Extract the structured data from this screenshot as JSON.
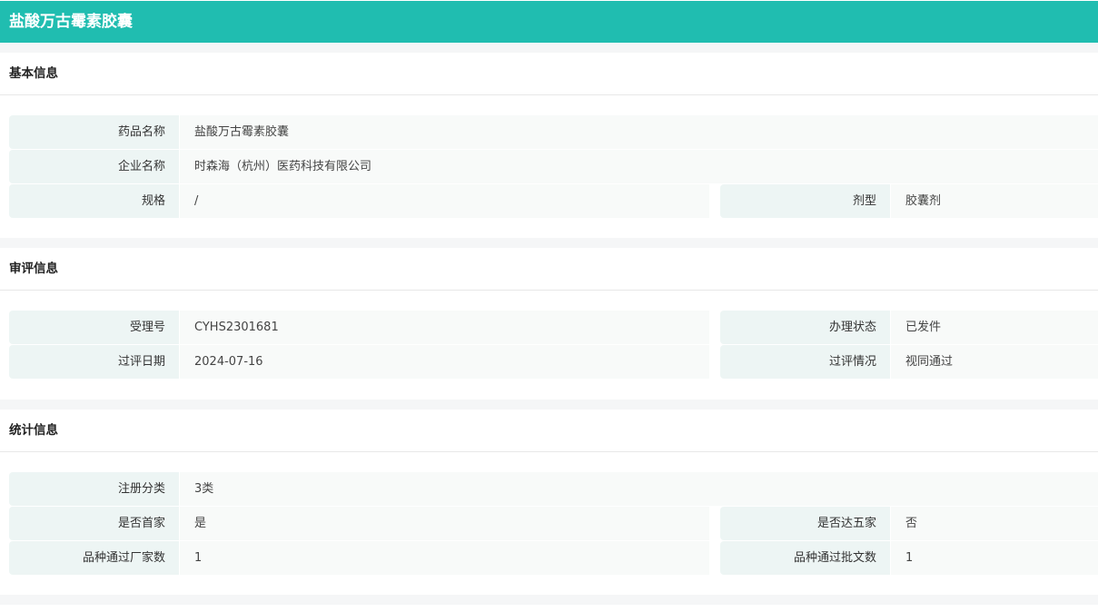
{
  "title": "盐酸万古霉素胶囊",
  "sections": [
    {
      "title": "基本信息",
      "rows": [
        [
          {
            "label": "药品名称",
            "value": "盐酸万古霉素胶囊"
          }
        ],
        [
          {
            "label": "企业名称",
            "value": "时森海（杭州）医药科技有限公司"
          }
        ],
        [
          {
            "label": "规格",
            "value": "/"
          },
          {
            "label": "剂型",
            "value": "胶囊剂"
          }
        ]
      ]
    },
    {
      "title": "审评信息",
      "rows": [
        [
          {
            "label": "受理号",
            "value": "CYHS2301681"
          },
          {
            "label": "办理状态",
            "value": "已发件"
          }
        ],
        [
          {
            "label": "过评日期",
            "value": "2024-07-16"
          },
          {
            "label": "过评情况",
            "value": "视同通过"
          }
        ]
      ]
    },
    {
      "title": "统计信息",
      "rows": [
        [
          {
            "label": "注册分类",
            "value": "3类"
          }
        ],
        [
          {
            "label": "是否首家",
            "value": "是"
          },
          {
            "label": "是否达五家",
            "value": "否"
          }
        ],
        [
          {
            "label": "品种通过厂家数",
            "value": "1"
          },
          {
            "label": "品种通过批文数",
            "value": "1"
          }
        ]
      ]
    }
  ]
}
